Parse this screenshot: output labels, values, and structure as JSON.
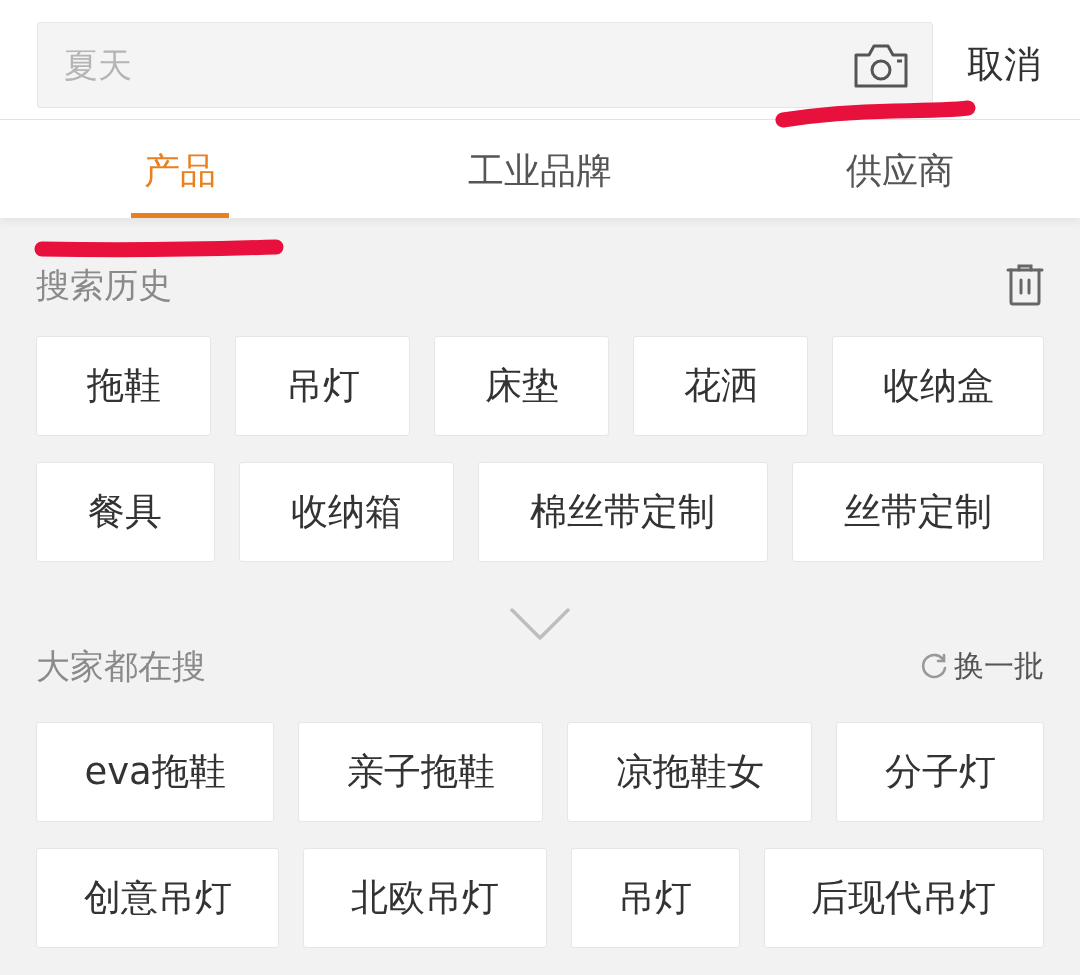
{
  "search": {
    "placeholder": "夏天",
    "cancel": "取消"
  },
  "tabs": [
    {
      "label": "产品",
      "selected": true
    },
    {
      "label": "工业品牌",
      "selected": false
    },
    {
      "label": "供应商",
      "selected": false
    }
  ],
  "history": {
    "title": "搜索历史",
    "items": [
      "拖鞋",
      "吊灯",
      "床垫",
      "花洒",
      "收纳盒",
      "餐具",
      "收纳箱",
      "棉丝带定制",
      "丝带定制"
    ]
  },
  "popular": {
    "title": "大家都在搜",
    "refresh": "换一批",
    "items": [
      "eva拖鞋",
      "亲子拖鞋",
      "凉拖鞋女",
      "分子灯",
      "创意吊灯",
      "北欧吊灯",
      "吊灯",
      "后现代吊灯"
    ]
  }
}
